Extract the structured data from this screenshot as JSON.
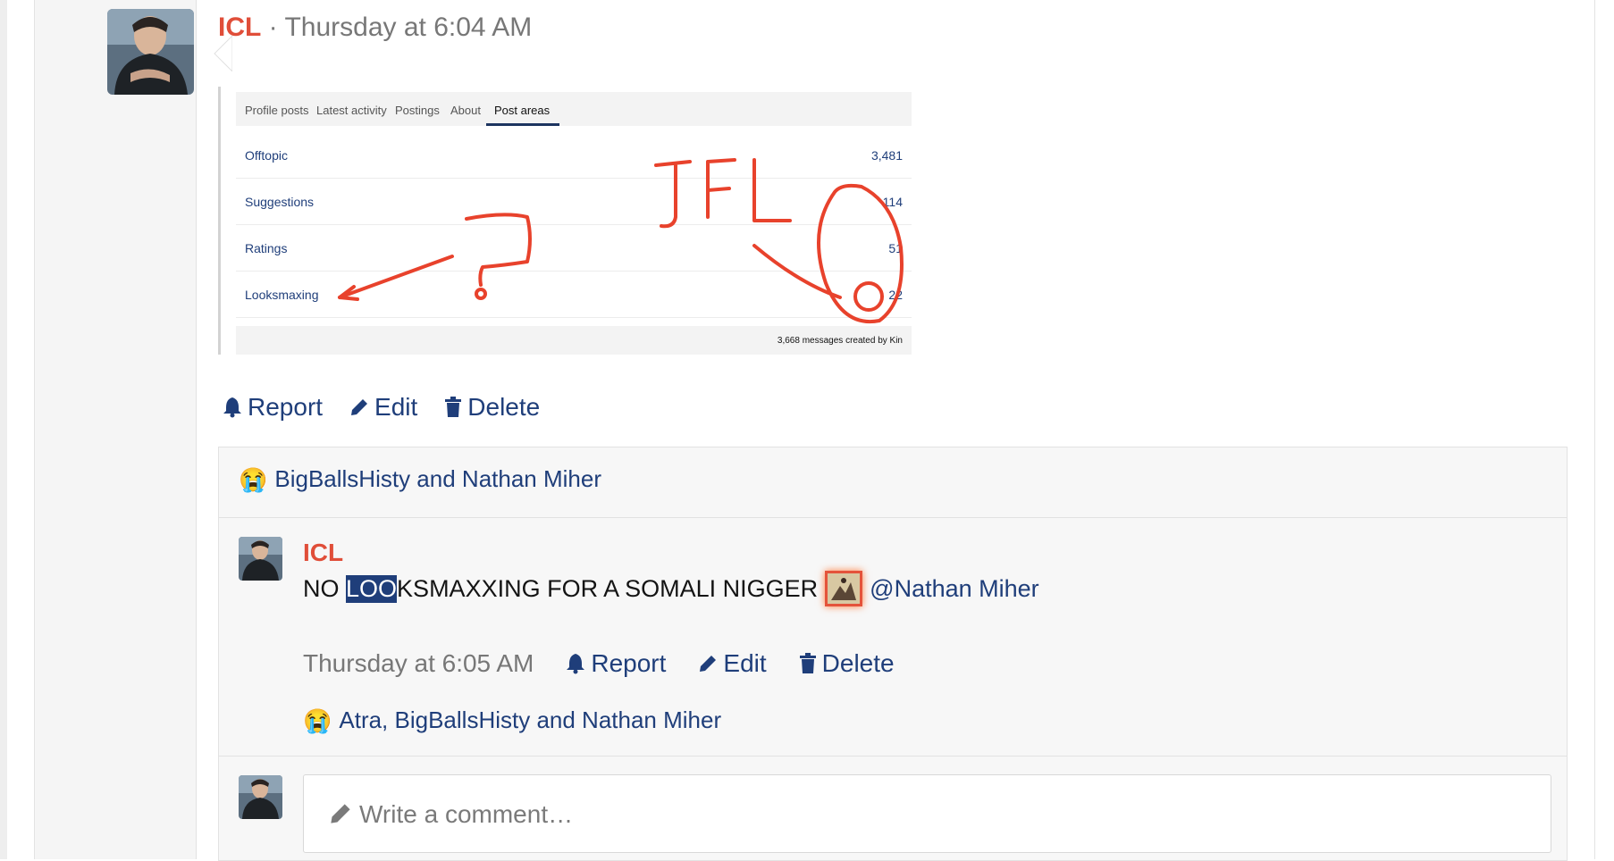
{
  "post": {
    "author": "ICL",
    "separator": " · ",
    "timestamp": "Thursday at 6:04 AM"
  },
  "attachment": {
    "tabs": [
      "Profile posts",
      "Latest activity",
      "Postings",
      "About",
      "Post areas"
    ],
    "active_tab": "Post areas",
    "rows": [
      {
        "label": "Offtopic",
        "count": "3,481"
      },
      {
        "label": "Suggestions",
        "count": "114"
      },
      {
        "label": "Ratings",
        "count": "51"
      },
      {
        "label": "Looksmaxing",
        "count": "22"
      }
    ],
    "footer": "3,668 messages created by Kin",
    "annotation_text": "JFL",
    "annotation_color": "#e8422c"
  },
  "actions": {
    "report": "Report",
    "edit": "Edit",
    "delete": "Delete"
  },
  "reactions": {
    "emoji": "😭",
    "names": "BigBallsHisty and Nathan Miher"
  },
  "comment": {
    "author": "ICL",
    "text_before": "NO ",
    "text_highlight": "LOO",
    "text_after": "KSMAXXING FOR A SOMALI NIGGER",
    "mention": "@Nathan Miher",
    "timestamp": "Thursday at 6:05 AM",
    "report": "Report",
    "edit": "Edit",
    "delete": "Delete",
    "reaction_emoji": "😭",
    "reaction_names": "Atra, BigBallsHisty and Nathan Miher"
  },
  "composer": {
    "placeholder": "Write a comment…"
  },
  "colors": {
    "accent": "#1f3e7a",
    "author": "#e04e39",
    "meta": "#777777"
  }
}
